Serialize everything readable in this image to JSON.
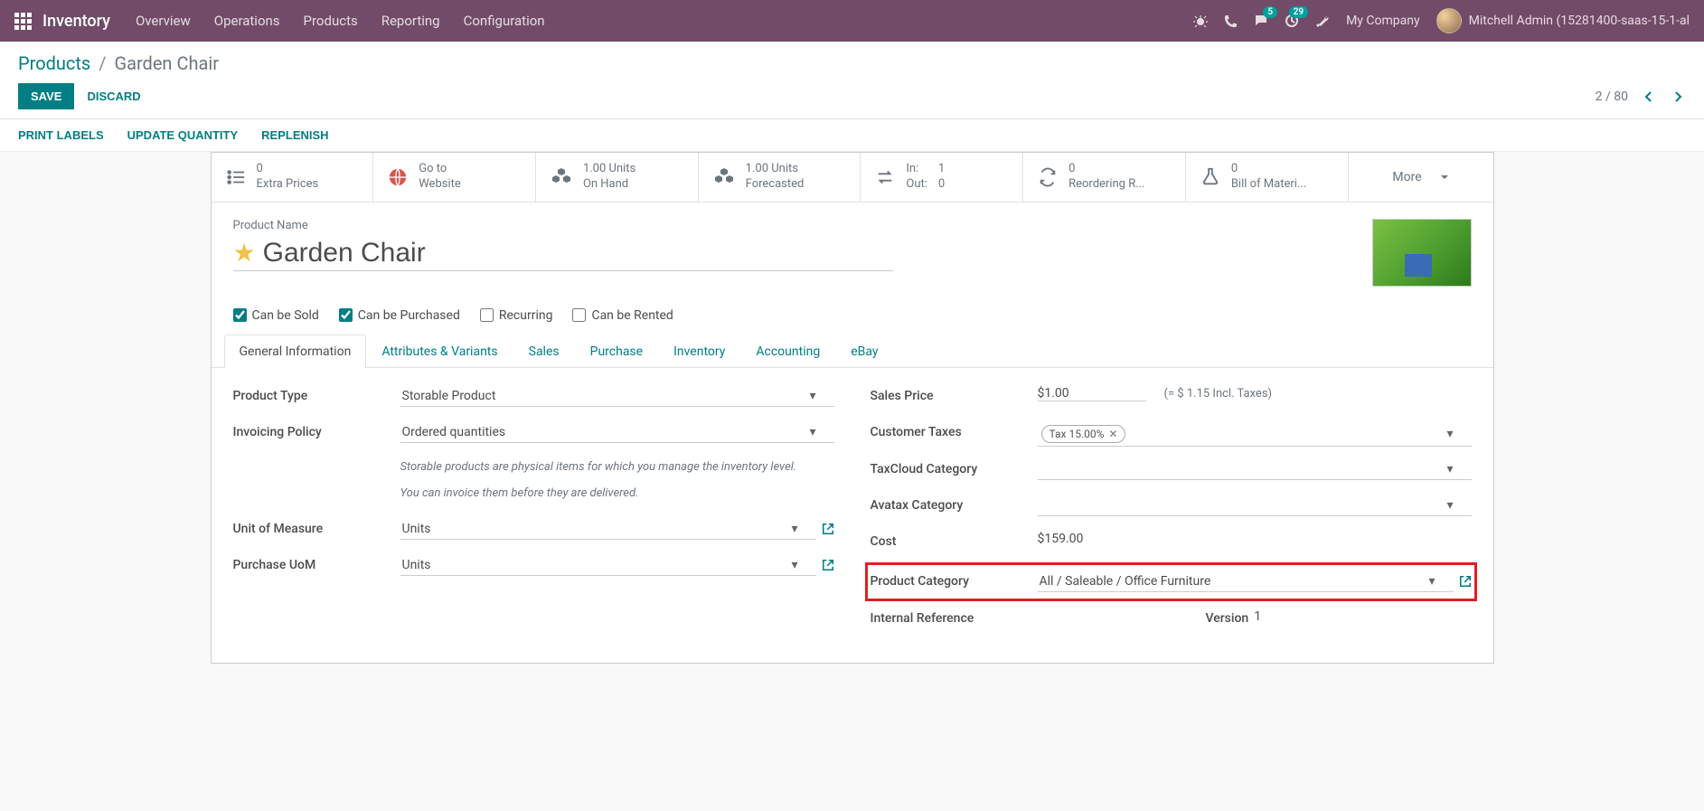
{
  "nav": {
    "brand": "Inventory",
    "menu": [
      "Overview",
      "Operations",
      "Products",
      "Reporting",
      "Configuration"
    ],
    "notif_badge": "5",
    "activity_badge": "29",
    "company": "My Company",
    "user": "Mitchell Admin (15281400-saas-15-1-al"
  },
  "breadcrumb": {
    "root": "Products",
    "current": "Garden Chair"
  },
  "buttons": {
    "save": "SAVE",
    "discard": "DISCARD"
  },
  "pager": {
    "text": "2 / 80"
  },
  "statusbar": [
    "PRINT LABELS",
    "UPDATE QUANTITY",
    "REPLENISH"
  ],
  "stat_buttons": {
    "extra_prices": {
      "value": "0",
      "label": "Extra Prices"
    },
    "website": {
      "l1": "Go to",
      "l2": "Website"
    },
    "onhand": {
      "value": "1.00 Units",
      "label": "On Hand"
    },
    "forecast": {
      "value": "1.00 Units",
      "label": "Forecasted"
    },
    "inout": {
      "in_l": "In:",
      "in_v": "1",
      "out_l": "Out:",
      "out_v": "0"
    },
    "reorder": {
      "value": "0",
      "label": "Reordering R..."
    },
    "bom": {
      "value": "0",
      "label": "Bill of Materi..."
    },
    "more": "More"
  },
  "title": {
    "label": "Product Name",
    "value": "Garden Chair"
  },
  "options": {
    "sold": "Can be Sold",
    "purchased": "Can be Purchased",
    "recurring": "Recurring",
    "rented": "Can be Rented"
  },
  "tabs": [
    "General Information",
    "Attributes & Variants",
    "Sales",
    "Purchase",
    "Inventory",
    "Accounting",
    "eBay"
  ],
  "left_col": {
    "product_type": {
      "label": "Product Type",
      "value": "Storable Product"
    },
    "invoicing": {
      "label": "Invoicing Policy",
      "value": "Ordered quantities"
    },
    "help1": "Storable products are physical items for which you manage the inventory level.",
    "help2": "You can invoice them before they are delivered.",
    "uom": {
      "label": "Unit of Measure",
      "value": "Units"
    },
    "puom": {
      "label": "Purchase UoM",
      "value": "Units"
    }
  },
  "right_col": {
    "sales_price": {
      "label": "Sales Price",
      "value": "$1.00",
      "hint": "(= $ 1.15 Incl. Taxes)"
    },
    "cust_taxes": {
      "label": "Customer Taxes",
      "tag": "Tax 15.00%"
    },
    "taxcloud": {
      "label": "TaxCloud Category"
    },
    "avatax": {
      "label": "Avatax Category"
    },
    "cost": {
      "label": "Cost",
      "value": "$159.00"
    },
    "category": {
      "label": "Product Category",
      "value": "All / Saleable / Office Furniture"
    },
    "iref": {
      "label": "Internal Reference"
    },
    "version": {
      "label": "Version",
      "value": "1"
    }
  }
}
